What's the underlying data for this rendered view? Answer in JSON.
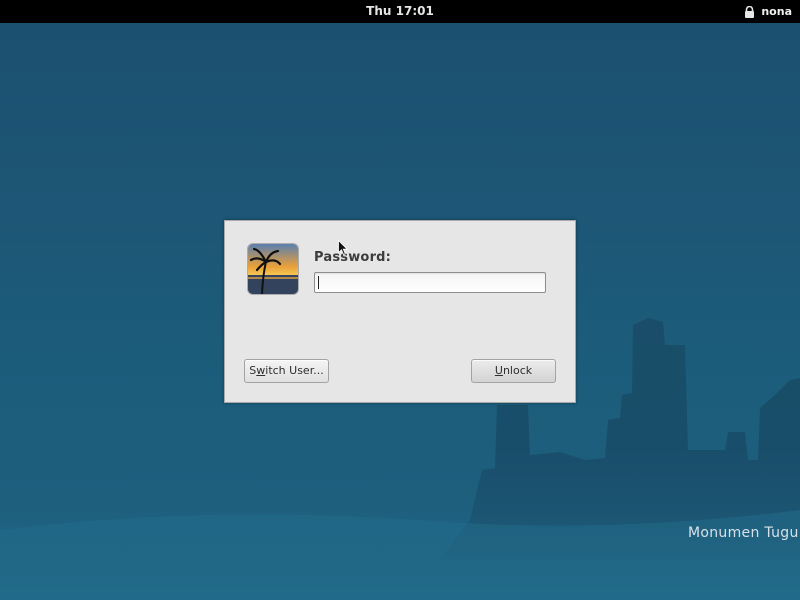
{
  "topbar": {
    "clock": "Thu 17:01",
    "username": "nona",
    "lock_icon": "lock-icon"
  },
  "lock_dialog": {
    "avatar_icon": "user-avatar-beach-sunset",
    "password_label": "Password:",
    "password_value": "",
    "switch_user": {
      "pre": "S",
      "mnemonic": "w",
      "post": "itch User..."
    },
    "unlock": {
      "pre": "",
      "mnemonic": "U",
      "post": "nlock"
    }
  },
  "wallpaper": {
    "caption": "Monumen Tugu"
  },
  "colors": {
    "topbar_bg": "#000000",
    "wallpaper_top": "#1c4f70",
    "wallpaper_bottom": "#1f6382",
    "dialog_bg": "#e6e6e6"
  }
}
